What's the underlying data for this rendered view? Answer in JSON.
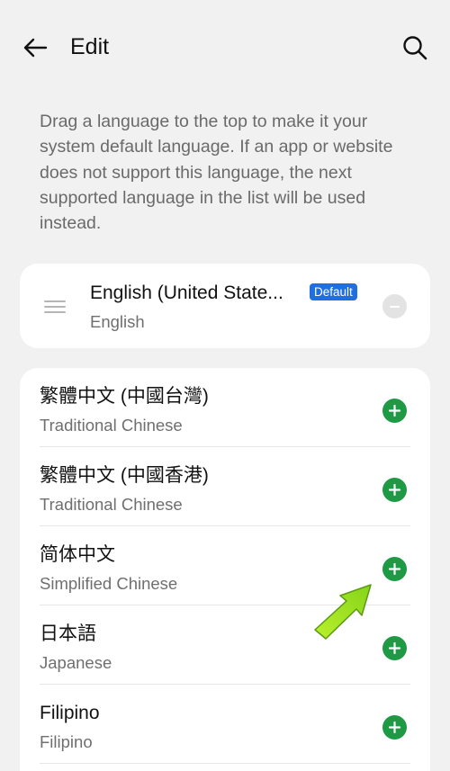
{
  "header": {
    "title": "Edit",
    "back_icon": "arrow-left-icon",
    "search_icon": "search-icon"
  },
  "description": "Drag a language to the top to make it your system default language. If an app or website does not support this language, the next supported language in the list will be used instead.",
  "default_language": {
    "name": "English (United State...",
    "subtitle": "English",
    "badge": "Default",
    "badge_color": "#1f6fe0"
  },
  "languages": [
    {
      "name": "繁體中文 (中國台灣)",
      "subtitle": "Traditional Chinese"
    },
    {
      "name": "繁體中文 (中國香港)",
      "subtitle": "Traditional Chinese"
    },
    {
      "name": "简体中文",
      "subtitle": "Simplified Chinese"
    },
    {
      "name": "日本語",
      "subtitle": "Japanese"
    },
    {
      "name": "Filipino",
      "subtitle": "Filipino"
    }
  ],
  "colors": {
    "add_button": "#1e9a45",
    "background": "#f1f1f1",
    "annotation_arrow": "#9be21a"
  }
}
